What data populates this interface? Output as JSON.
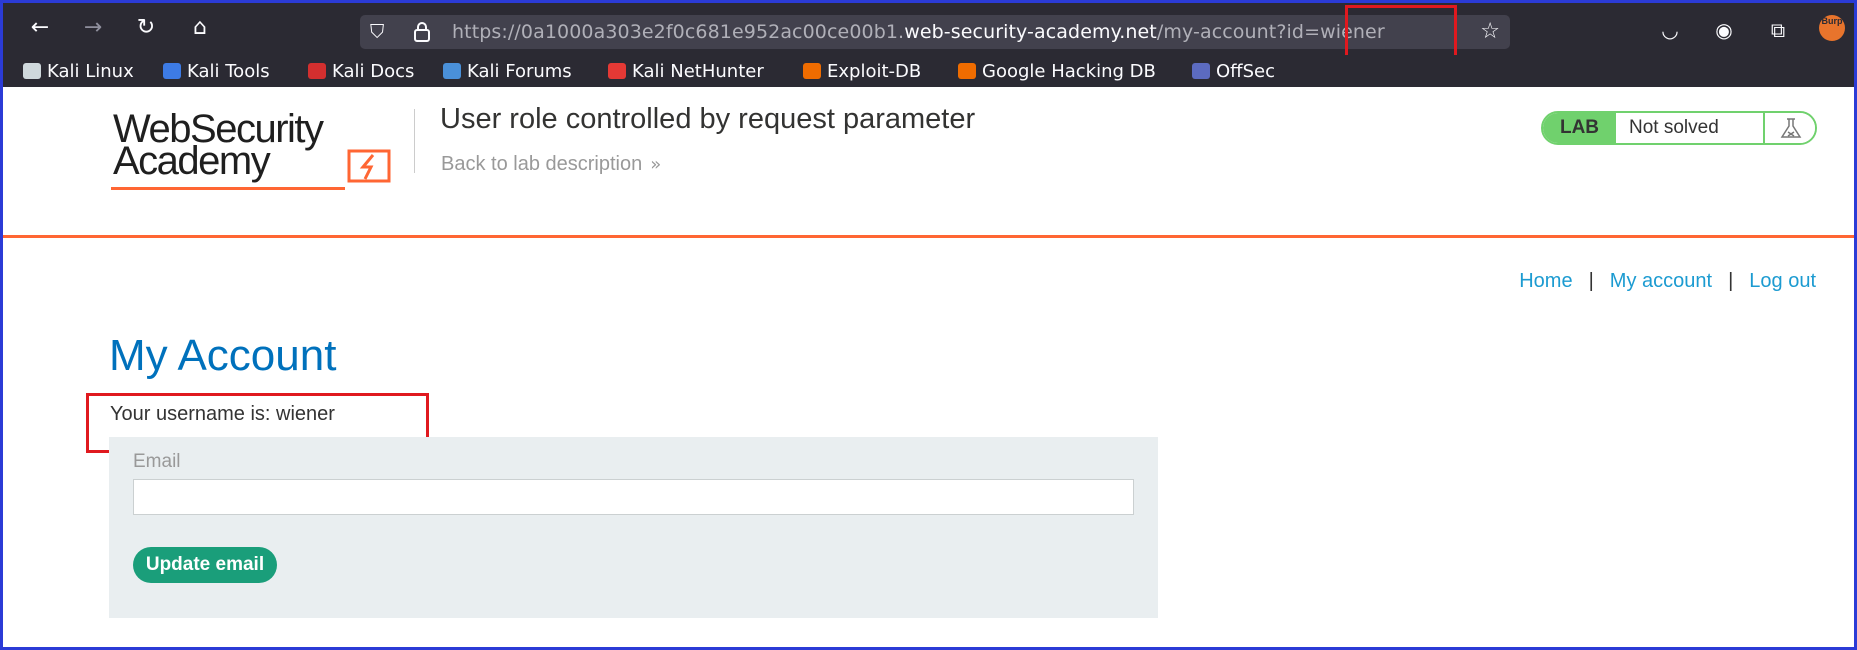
{
  "browser": {
    "url_prefix": "https://0a1000a303e2f0c681e952ac00ce00b1.",
    "url_host": "web-security-academy.net",
    "url_path": "/my-account?id=wiener",
    "burp_label": "Burp",
    "bookmarks": [
      {
        "label": "Kali Linux",
        "color": "#cfd8dc"
      },
      {
        "label": "Kali Tools",
        "color": "#3d7be5"
      },
      {
        "label": "Kali Docs",
        "color": "#d32f2f"
      },
      {
        "label": "Kali Forums",
        "color": "#4a90d9"
      },
      {
        "label": "Kali NetHunter",
        "color": "#e53935"
      },
      {
        "label": "Exploit-DB",
        "color": "#ef6c00"
      },
      {
        "label": "Google Hacking DB",
        "color": "#ef6c00"
      },
      {
        "label": "OffSec",
        "color": "#5c6bc0"
      }
    ]
  },
  "header": {
    "logo_line1": "WebSecurity",
    "logo_line2": "Academy",
    "lab_title": "User role controlled by request parameter",
    "back_link": "Back to lab description",
    "lab_badge": "LAB",
    "lab_status": "Not solved"
  },
  "nav": {
    "home": "Home",
    "my_account": "My account",
    "log_out": "Log out",
    "separator": "|"
  },
  "main": {
    "title": "My Account",
    "username_line": "Your username is: wiener",
    "email_label": "Email",
    "email_value": "",
    "update_button": "Update email"
  },
  "colors": {
    "annotation": "#e0191f",
    "accent_orange": "#ff6633",
    "link_blue": "#1c9bd1",
    "title_blue": "#0071bc",
    "button_green": "#1a9e7a",
    "lab_green": "#70d16d"
  }
}
